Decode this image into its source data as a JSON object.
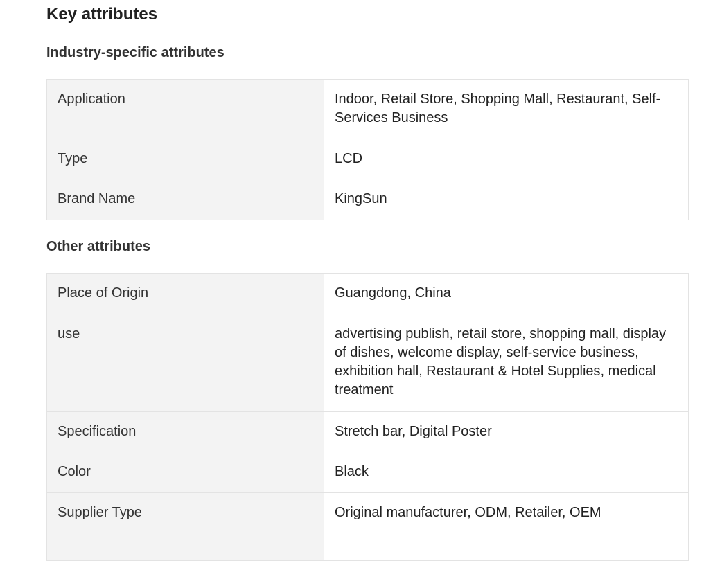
{
  "page": {
    "title": "Key attributes"
  },
  "sections": [
    {
      "title": "Industry-specific attributes",
      "rows": [
        {
          "name": "Application",
          "value": "Indoor, Retail Store, Shopping Mall, Restaurant, Self-Services Business"
        },
        {
          "name": "Type",
          "value": "LCD"
        },
        {
          "name": "Brand Name",
          "value": "KingSun"
        }
      ]
    },
    {
      "title": "Other attributes",
      "rows": [
        {
          "name": "Place of Origin",
          "value": "Guangdong, China"
        },
        {
          "name": "use",
          "value": "advertising publish, retail store, shopping mall, display of dishes, welcome display, self-service business, exhibition hall, Restaurant & Hotel Supplies, medical treatment"
        },
        {
          "name": "Specification",
          "value": "Stretch bar, Digital Poster"
        },
        {
          "name": "Color",
          "value": "Black"
        },
        {
          "name": "Supplier Type",
          "value": "Original manufacturer, ODM, Retailer, OEM"
        }
      ]
    }
  ]
}
